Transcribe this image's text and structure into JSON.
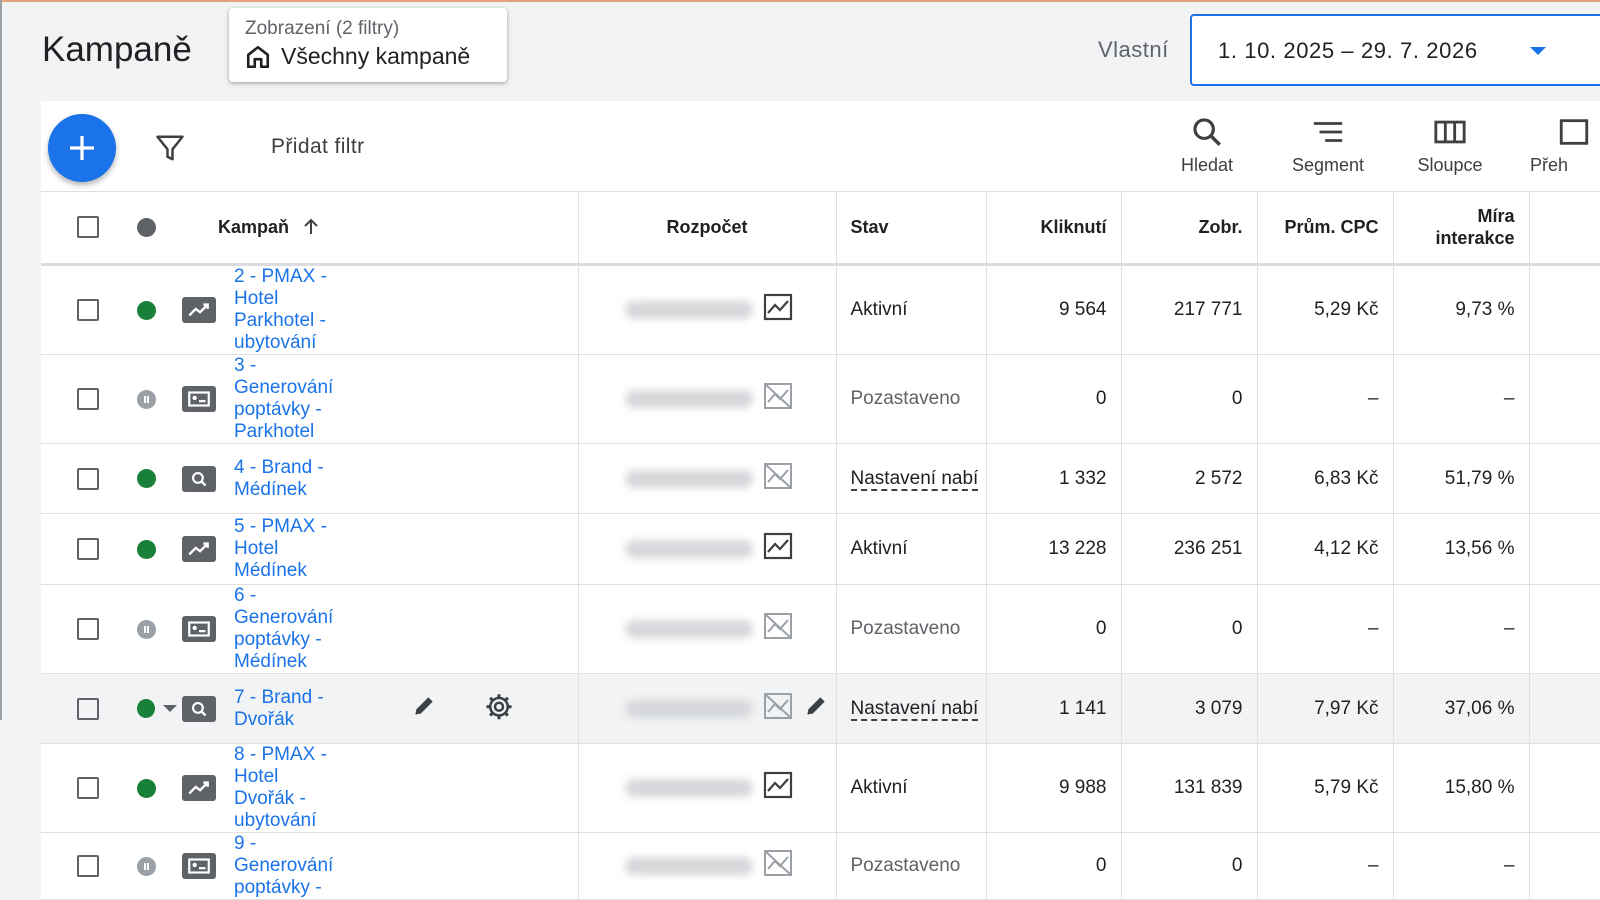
{
  "page": {
    "title": "Kampaně"
  },
  "view": {
    "label": "Zobrazení (2 filtry)",
    "value": "Všechny kampaně",
    "icon": "home-icon"
  },
  "date_range": {
    "label": "Vlastní",
    "value": "1. 10. 2025 – 29. 7. 2026"
  },
  "toolbar": {
    "add_filter": "Přidat filtr",
    "tools": [
      {
        "label": "Hledat",
        "icon": "search-icon"
      },
      {
        "label": "Segment",
        "icon": "segment-icon"
      },
      {
        "label": "Sloupce",
        "icon": "columns-icon"
      },
      {
        "label": "Přeh",
        "icon": "report-icon"
      }
    ]
  },
  "table": {
    "headers": {
      "campaign": "Kampaň",
      "budget": "Rozpočet",
      "status": "Stav",
      "clicks": "Kliknutí",
      "impressions": "Zobr.",
      "cpc": "Prům. CPC",
      "interaction_line1": "Míra",
      "interaction_line2": "interakce"
    },
    "rows": [
      {
        "name": "2 - PMAX - Hotel Parkhotel - ubytování",
        "type": "pmax",
        "state": "active",
        "chart": "on",
        "status": "Aktivní",
        "status_kind": "plain",
        "clicks": "9 564",
        "impressions": "217 771",
        "cpc": "5,29 Kč",
        "interaction": "9,73 %"
      },
      {
        "name": "3 - Generování poptávky - Parkhotel",
        "type": "demand",
        "state": "paused",
        "chart": "off",
        "status": "Pozastaveno",
        "status_kind": "paused",
        "clicks": "0",
        "impressions": "0",
        "cpc": "–",
        "interaction": "–"
      },
      {
        "name": "4 - Brand - Médínek",
        "type": "search",
        "state": "active",
        "chart": "off",
        "status": "Nastavení nabí",
        "status_kind": "link",
        "clicks": "1 332",
        "impressions": "2 572",
        "cpc": "6,83 Kč",
        "interaction": "51,79 %"
      },
      {
        "name": "5 - PMAX - Hotel Médínek",
        "type": "pmax",
        "state": "active",
        "chart": "on",
        "status": "Aktivní",
        "status_kind": "plain",
        "clicks": "13 228",
        "impressions": "236 251",
        "cpc": "4,12 Kč",
        "interaction": "13,56 %"
      },
      {
        "name": "6 - Generování poptávky - Médínek",
        "type": "demand",
        "state": "paused",
        "chart": "off",
        "status": "Pozastaveno",
        "status_kind": "paused",
        "clicks": "0",
        "impressions": "0",
        "cpc": "–",
        "interaction": "–"
      },
      {
        "name": "7 - Brand - Dvořák",
        "type": "search",
        "state": "active",
        "chart": "off",
        "status": "Nastavení nabí",
        "status_kind": "link",
        "clicks": "1 141",
        "impressions": "3 079",
        "cpc": "7,97 Kč",
        "interaction": "37,06 %",
        "hover": true
      },
      {
        "name": "8 - PMAX - Hotel Dvořák - ubytování",
        "type": "pmax",
        "state": "active",
        "chart": "on",
        "status": "Aktivní",
        "status_kind": "plain",
        "clicks": "9 988",
        "impressions": "131 839",
        "cpc": "5,79 Kč",
        "interaction": "15,80 %"
      },
      {
        "name": "9 - Generování poptávky -",
        "type": "demand",
        "state": "paused",
        "chart": "off",
        "status": "Pozastaveno",
        "status_kind": "paused",
        "clicks": "0",
        "impressions": "0",
        "cpc": "–",
        "interaction": "–"
      }
    ]
  },
  "colors": {
    "accent": "#1a73e8",
    "active": "#188038",
    "paused": "#9aa0a6"
  }
}
